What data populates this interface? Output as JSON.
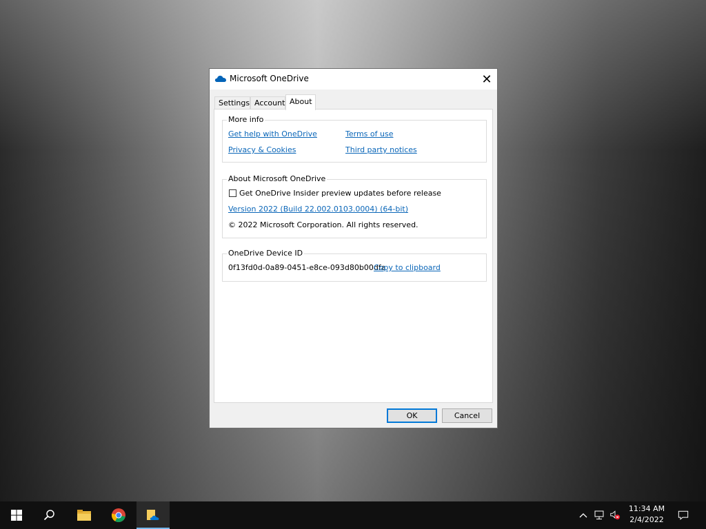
{
  "dialog": {
    "title": "Microsoft OneDrive",
    "close_glyph": "✕",
    "tabs": [
      {
        "label": "Settings"
      },
      {
        "label": "Account"
      },
      {
        "label": "About"
      }
    ],
    "active_tab": "About",
    "more_info": {
      "label": "More info",
      "help_link": "Get help with OneDrive",
      "terms_link": "Terms of use",
      "privacy_link": "Privacy & Cookies",
      "third_party_link": "Third party notices"
    },
    "about": {
      "label": "About Microsoft OneDrive",
      "insider_checkbox_label": "Get OneDrive Insider preview updates before release",
      "insider_checked": false,
      "version_link": "Version  2022 (Build 22.002.0103.0004) (64-bit)",
      "copyright": "©  2022 Microsoft Corporation. All rights reserved."
    },
    "device": {
      "label": "OneDrive Device ID",
      "id": "0f13fd0d-0a89-0451-e8ce-093d80b00dfa",
      "copy_link": "Copy to clipboard"
    },
    "ok_label": "OK",
    "cancel_label": "Cancel"
  },
  "taskbar": {
    "time": "11:34 AM",
    "date": "2/4/2022"
  },
  "colors": {
    "link": "#0a66b8",
    "accent": "#0078d7",
    "taskbar": "#101010"
  }
}
